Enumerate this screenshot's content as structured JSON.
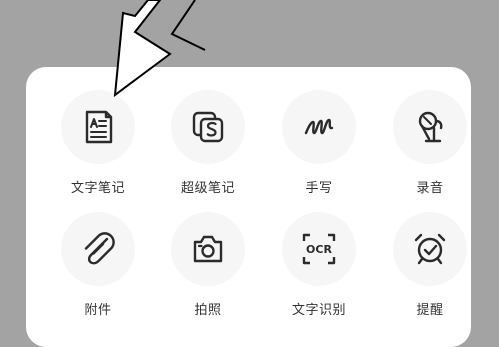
{
  "bottom_sheet": {
    "items": [
      {
        "label": "文字笔记",
        "icon": "text-note-icon"
      },
      {
        "label": "超级笔记",
        "icon": "super-note-icon"
      },
      {
        "label": "手写",
        "icon": "handwriting-icon"
      },
      {
        "label": "录音",
        "icon": "microphone-icon"
      },
      {
        "label": "附件",
        "icon": "paperclip-icon"
      },
      {
        "label": "拍照",
        "icon": "camera-icon"
      },
      {
        "label": "文字识别",
        "icon": "ocr-icon"
      },
      {
        "label": "提醒",
        "icon": "alarm-clock-icon"
      }
    ],
    "ocr_icon_text": "OCR"
  },
  "annotation": {
    "color": "#000000"
  }
}
